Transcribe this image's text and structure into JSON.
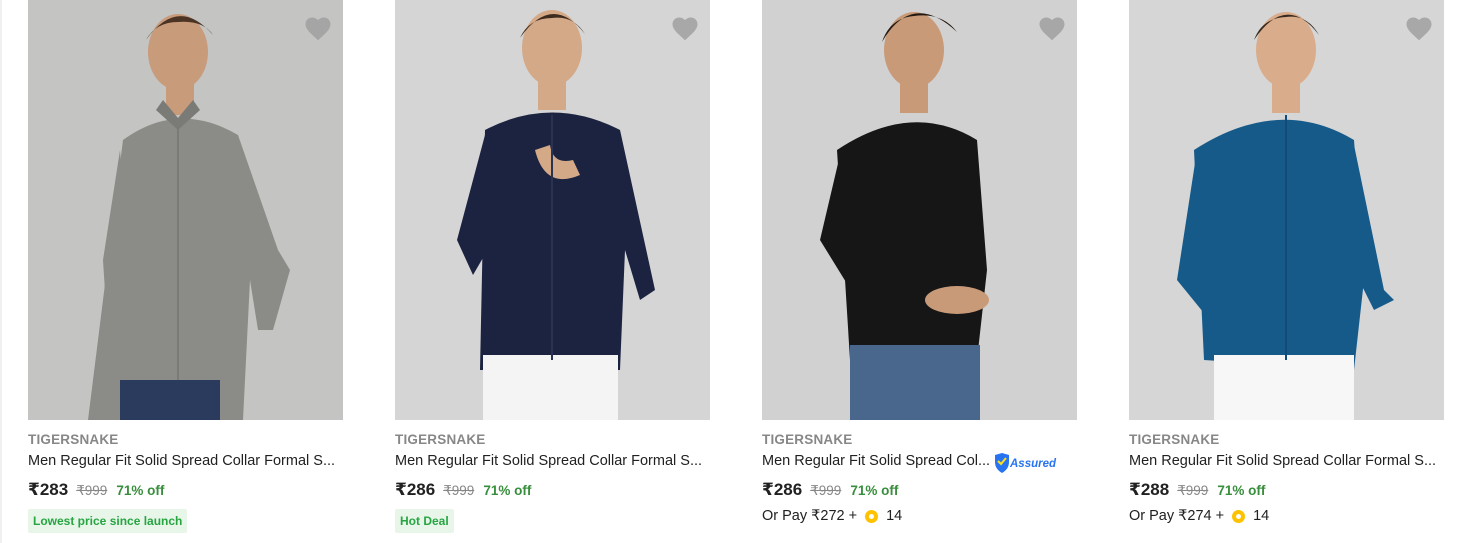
{
  "colors": {
    "accent_green": "#388e3c",
    "badge_green": "#26a541",
    "badge_bg": "#e8f6ea",
    "muted": "#878787",
    "wishlist": "#a0a0a0"
  },
  "products": [
    {
      "brand": "TIGERSNAKE",
      "title": "Men Regular Fit Solid Spread Collar Formal S...",
      "price": "₹283",
      "mrp": "₹999",
      "discount": "71% off",
      "badge": "Lowest price since launch",
      "shirt_color": "#8b8c87",
      "bg": "#c4c4c2",
      "pants": "#2a3b5e"
    },
    {
      "brand": "TIGERSNAKE",
      "title": "Men Regular Fit Solid Spread Collar Formal S...",
      "price": "₹286",
      "mrp": "₹999",
      "discount": "71% off",
      "badge": "Hot Deal",
      "shirt_color": "#1c2340",
      "bg": "#d5d5d5",
      "pants": "#f4f4f4"
    },
    {
      "brand": "TIGERSNAKE",
      "title": "Men Regular Fit Solid Spread Col...",
      "price": "₹286",
      "mrp": "₹999",
      "discount": "71% off",
      "assured_label": "Assured",
      "or_pay_prefix": "Or Pay ₹272 +",
      "coins": "14",
      "shirt_color": "#161616",
      "bg": "#d1d1d1",
      "pants": "#49678c"
    },
    {
      "brand": "TIGERSNAKE",
      "title": "Men Regular Fit Solid Spread Collar Formal S...",
      "price": "₹288",
      "mrp": "₹999",
      "discount": "71% off",
      "or_pay_prefix": "Or Pay ₹274 +",
      "coins": "14",
      "shirt_color": "#165a8a",
      "bg": "#d6d6d6",
      "pants": "#f7f7f7"
    }
  ]
}
